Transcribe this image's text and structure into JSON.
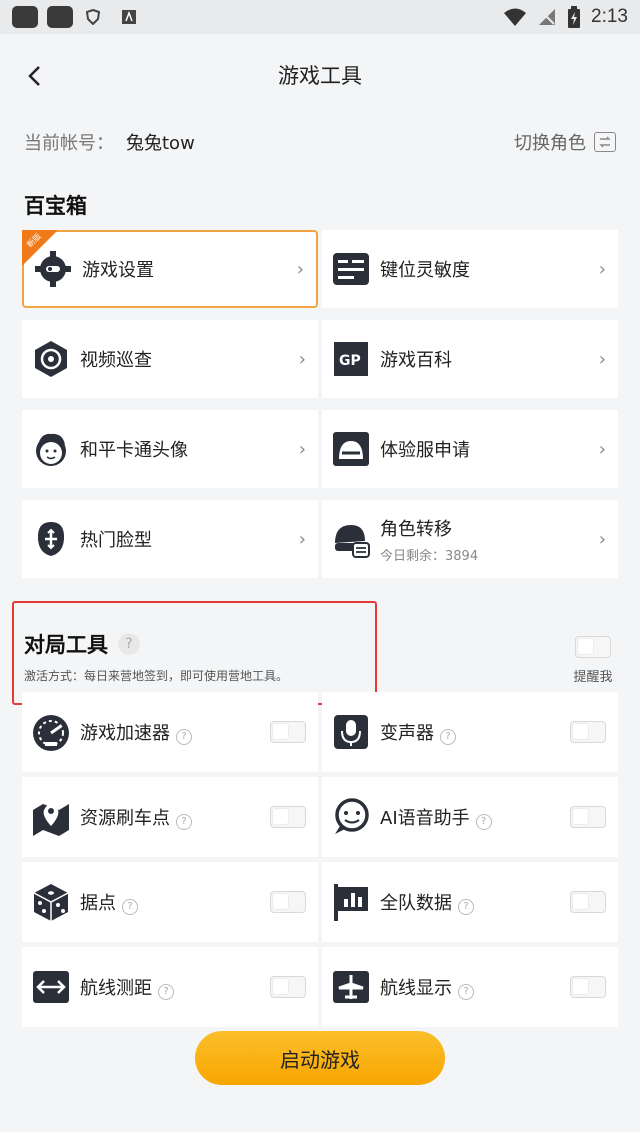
{
  "status_bar": {
    "time": "2:13"
  },
  "header": {
    "title": "游戏工具"
  },
  "account": {
    "label": "当前帐号：",
    "name": "兔兔tow",
    "switch_label": "切换角色"
  },
  "treasure": {
    "title": "百宝箱",
    "new_badge": "新版",
    "items": [
      {
        "label": "游戏设置",
        "icon": "gear-icon"
      },
      {
        "label": "键位灵敏度",
        "icon": "keyboard-icon"
      },
      {
        "label": "视频巡查",
        "icon": "target-icon"
      },
      {
        "label": "游戏百科",
        "icon": "gp-book-icon"
      },
      {
        "label": "和平卡通头像",
        "icon": "cartoon-face-icon"
      },
      {
        "label": "体验服申请",
        "icon": "helmet-card-icon"
      },
      {
        "label": "热门脸型",
        "icon": "face-shape-icon"
      },
      {
        "label": "角色转移",
        "sub": "今日剩余：3894",
        "icon": "character-transfer-icon"
      }
    ]
  },
  "battle": {
    "title": "对局工具",
    "help": "?",
    "desc": "激活方式：每日来营地签到，即可使用营地工具。",
    "remind_label": "提醒我",
    "items": [
      {
        "label": "游戏加速器",
        "icon": "speedometer-icon"
      },
      {
        "label": "变声器",
        "icon": "microphone-icon"
      },
      {
        "label": "资源刷车点",
        "icon": "map-pin-icon"
      },
      {
        "label": "AI语音助手",
        "icon": "chat-bot-icon"
      },
      {
        "label": "据点",
        "icon": "dice-icon"
      },
      {
        "label": "全队数据",
        "icon": "flag-chart-icon"
      },
      {
        "label": "航线测距",
        "icon": "arrows-icon"
      },
      {
        "label": "航线显示",
        "icon": "plane-icon"
      }
    ]
  },
  "launch": {
    "label": "启动游戏"
  },
  "colors": {
    "accent": "#f7a600",
    "highlight_border": "#f0a443",
    "red_box": "#e53935"
  }
}
